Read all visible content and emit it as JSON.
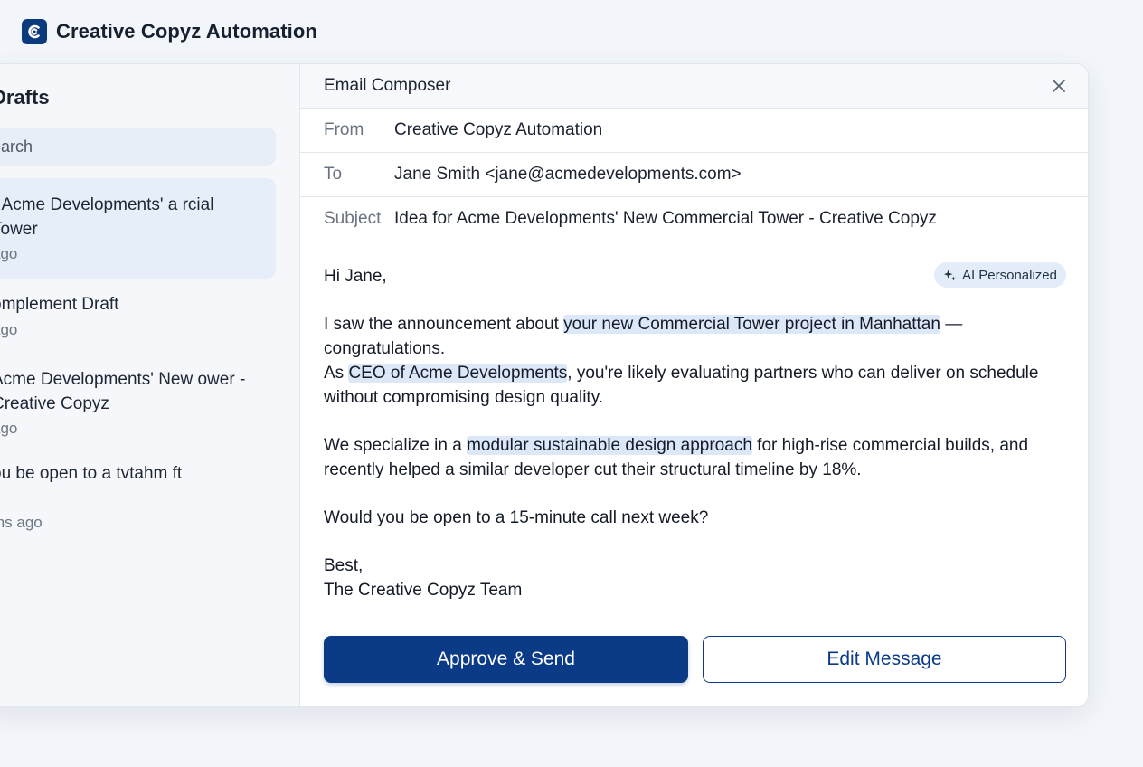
{
  "app": {
    "title": "Creative Copyz Automation"
  },
  "sidebar": {
    "title": "Drafts",
    "search_placeholder": "earch",
    "items": [
      {
        "title": "r Acme Developments' a rcial Tower",
        "time": " ago",
        "active": true
      },
      {
        "title": "omplement Draft",
        "time": " ago",
        "active": false
      },
      {
        "title": "Acme Developments' New ower - Creative Copyz",
        "time": " ago",
        "active": false
      },
      {
        "title": "ou be open to a tvtahm ft",
        "time": "ths ago",
        "active": false
      }
    ]
  },
  "composer": {
    "title": "Email Composer",
    "from_label": "From",
    "from_value": "Creative Copyz Automation",
    "to_label": "To",
    "to_value": "Jane Smith <jane@acmedevelopments.com>",
    "subject_label": "Subject",
    "subject_value": "Idea for Acme Developments' New Commercial Tower - Creative Copyz",
    "ai_badge": "AI Personalized",
    "body": {
      "greeting": "Hi Jane,",
      "p1_pre": "I saw the announcement about ",
      "p1_hl": "your new Commercial Tower project in Manhattan",
      "p1_post": " —\ncongratulations.\nAs ",
      "p2_hl": "CEO of Acme Developments",
      "p2_post": ", you're likely evaluating partners who can deliver on schedule\nwithout compromising design quality.\n\nWe specialize in a ",
      "p3_hl": "modular sustainable design approach",
      "p3_post": " for high-rise commercial builds, and\nrecently helped a similar developer cut their structural timeline by 18%.\n\nWould you be open to a 15-minute call next week?\n\nBest,\nThe Creative Copyz Team"
    },
    "approve_label": "Approve & Send",
    "edit_label": "Edit Message"
  },
  "colors": {
    "brand": "#0b3b86",
    "highlight": "#dce8f8",
    "sidebar_active": "#e6eef9"
  }
}
